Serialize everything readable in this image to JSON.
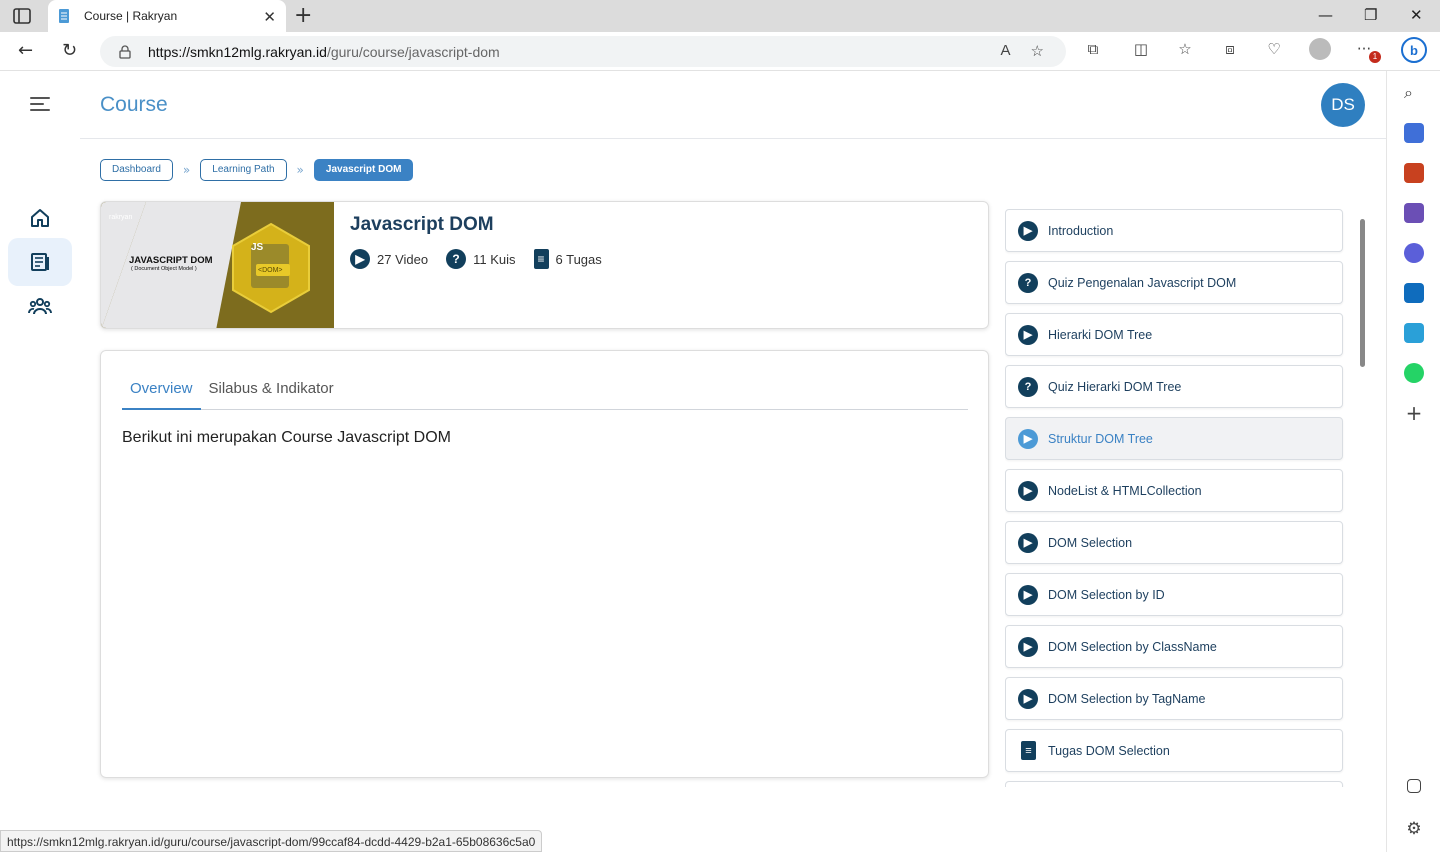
{
  "browser": {
    "tab_title": "Course | Rakryan",
    "url_host": "https://smkn12mlg.rakryan.id",
    "url_path": "/guru/course/javascript-dom",
    "status_url": "https://smkn12mlg.rakryan.id/guru/course/javascript-dom/99ccaf84-dcdd-4429-b2a1-65b08636c5a0",
    "notification_count": "1"
  },
  "header": {
    "title": "Course",
    "avatar_initials": "DS"
  },
  "breadcrumb": {
    "items": [
      "Dashboard",
      "Learning Path",
      "Javascript DOM"
    ]
  },
  "course": {
    "name": "Javascript DOM",
    "thumb_title": "JAVASCRIPT DOM",
    "thumb_subtitle": "( Document Object Model )",
    "thumb_badge": "<DOM>",
    "thumb_brand": "rakryan",
    "video_count": "27 Video",
    "quiz_count": "11 Kuis",
    "task_count": "6 Tugas"
  },
  "tabs": {
    "overview": "Overview",
    "syllabus": "Silabus & Indikator"
  },
  "overview_text": "Berikut ini merupakan Course Javascript DOM",
  "lessons": [
    {
      "label": "Introduction",
      "type": "video"
    },
    {
      "label": "Quiz Pengenalan Javascript DOM",
      "type": "quiz"
    },
    {
      "label": "Hierarki DOM Tree",
      "type": "video"
    },
    {
      "label": "Quiz Hierarki DOM Tree",
      "type": "quiz"
    },
    {
      "label": "Struktur DOM Tree",
      "type": "video"
    },
    {
      "label": "NodeList & HTMLCollection",
      "type": "video"
    },
    {
      "label": "DOM Selection",
      "type": "video"
    },
    {
      "label": "DOM Selection by ID",
      "type": "video"
    },
    {
      "label": "DOM Selection by ClassName",
      "type": "video"
    },
    {
      "label": "DOM Selection by TagName",
      "type": "video"
    },
    {
      "label": "Tugas DOM Selection",
      "type": "task"
    }
  ],
  "colors": {
    "primary": "#3b82c4",
    "dark": "#123f5c",
    "title": "#1d3f5e"
  }
}
